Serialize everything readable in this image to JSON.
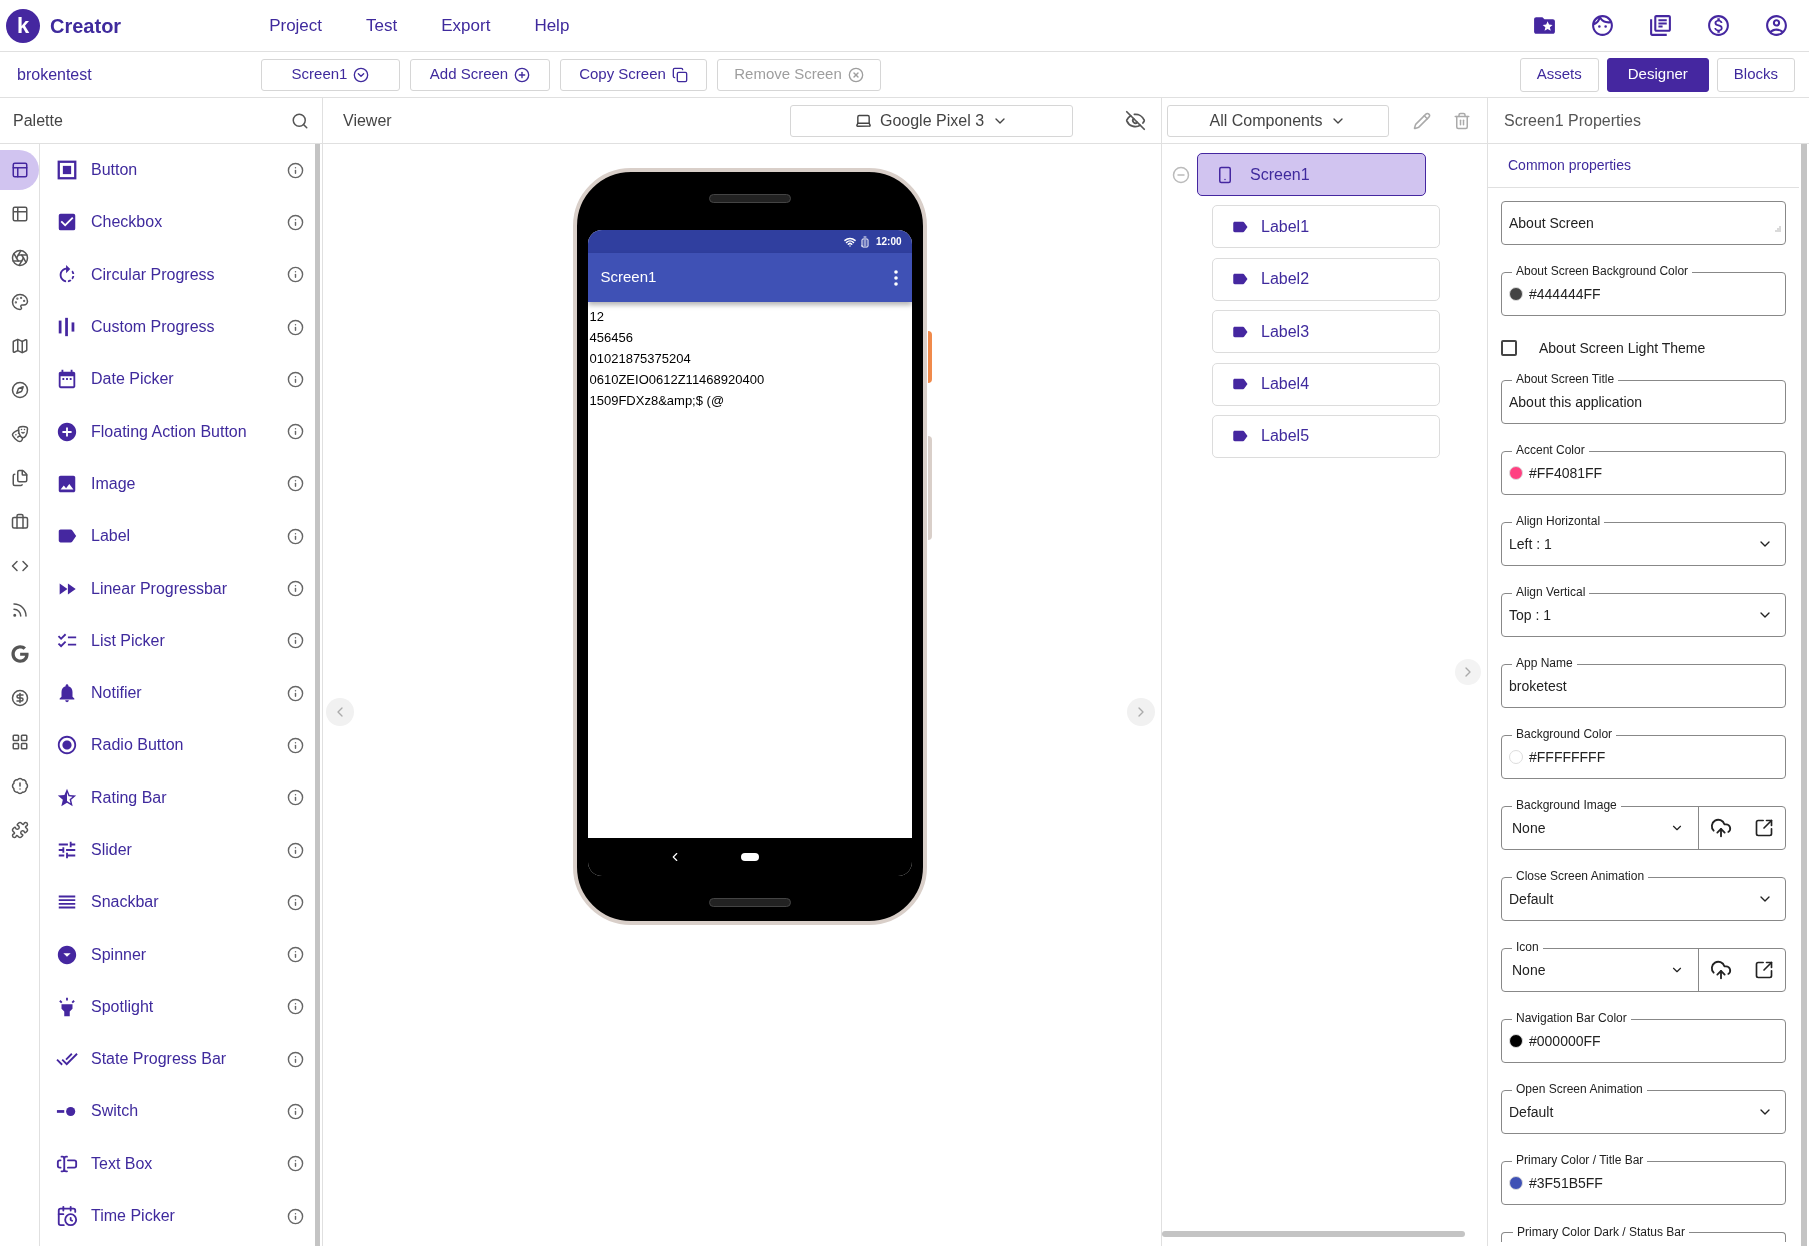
{
  "app": {
    "logo_mark": "k",
    "name": "Creator"
  },
  "menu": [
    "Project",
    "Test",
    "Export",
    "Help"
  ],
  "project": {
    "name": "brokentest"
  },
  "screen_actions": [
    {
      "kind": "dropdown",
      "label": "Screen1",
      "disabled": false
    },
    {
      "kind": "add",
      "label": "Add Screen",
      "disabled": false
    },
    {
      "kind": "copy",
      "label": "Copy Screen",
      "disabled": false
    },
    {
      "kind": "remove",
      "label": "Remove Screen",
      "disabled": true
    }
  ],
  "view_tabs": [
    {
      "label": "Assets",
      "selected": false
    },
    {
      "label": "Designer",
      "selected": true
    },
    {
      "label": "Blocks",
      "selected": false
    }
  ],
  "palette": {
    "title": "Palette",
    "categories": [
      {
        "selected": true
      },
      {
        "selected": false
      },
      {
        "selected": false
      },
      {
        "selected": false
      },
      {
        "selected": false
      },
      {
        "selected": false
      },
      {
        "selected": false
      },
      {
        "selected": false
      },
      {
        "selected": false
      },
      {
        "selected": false
      },
      {
        "selected": false
      },
      {
        "selected": false
      },
      {
        "selected": false
      },
      {
        "selected": false
      },
      {
        "selected": false
      },
      {
        "selected": false
      }
    ],
    "items": [
      "Button",
      "Checkbox",
      "Circular Progress",
      "Custom Progress",
      "Date Picker",
      "Floating Action Button",
      "Image",
      "Label",
      "Linear Progressbar",
      "List Picker",
      "Notifier",
      "Radio Button",
      "Rating Bar",
      "Slider",
      "Snackbar",
      "Spinner",
      "Spotlight",
      "State Progress Bar",
      "Switch",
      "Text Box",
      "Time Picker"
    ]
  },
  "viewer": {
    "title": "Viewer",
    "device": "Google Pixel 3",
    "phone": {
      "status_time": "12:00",
      "title": "Screen1",
      "labels": [
        "12",
        "456456",
        "01021875375204",
        "0610ZEIO0612Z11468920400",
        "1509FDXz8&amp;$ (@"
      ]
    }
  },
  "components": {
    "filter": "All Components",
    "tree": [
      {
        "name": "Screen1",
        "kind": "screen",
        "selected": true,
        "expanded": true,
        "children": [
          {
            "name": "Label1",
            "kind": "label",
            "selected": false
          },
          {
            "name": "Label2",
            "kind": "label",
            "selected": false
          },
          {
            "name": "Label3",
            "kind": "label",
            "selected": false
          },
          {
            "name": "Label4",
            "kind": "label",
            "selected": false
          },
          {
            "name": "Label5",
            "kind": "label",
            "selected": false
          }
        ]
      }
    ]
  },
  "properties": {
    "title": "Screen1 Properties",
    "section": "Common properties",
    "items": [
      {
        "kind": "textarea",
        "value": "About Screen"
      },
      {
        "kind": "color",
        "label": "About Screen Background Color",
        "value": "#444444FF",
        "color": "#444444"
      },
      {
        "kind": "checkbox",
        "label": "About Screen Light Theme",
        "checked": false
      },
      {
        "kind": "text",
        "label": "About Screen Title",
        "value": "About this application"
      },
      {
        "kind": "color",
        "label": "Accent Color",
        "value": "#FF4081FF",
        "color": "#ff4081"
      },
      {
        "kind": "select",
        "label": "Align Horizontal",
        "value": "Left : 1"
      },
      {
        "kind": "select",
        "label": "Align Vertical",
        "value": "Top : 1"
      },
      {
        "kind": "text",
        "label": "App Name",
        "value": "broketest"
      },
      {
        "kind": "color",
        "label": "Background Color",
        "value": "#FFFFFFFF",
        "color": "#ffffff"
      },
      {
        "kind": "asset",
        "label": "Background Image",
        "value": "None"
      },
      {
        "kind": "select",
        "label": "Close Screen Animation",
        "value": "Default"
      },
      {
        "kind": "asset",
        "label": "Icon",
        "value": "None"
      },
      {
        "kind": "color",
        "label": "Navigation Bar Color",
        "value": "#000000FF",
        "color": "#000000"
      },
      {
        "kind": "select",
        "label": "Open Screen Animation",
        "value": "Default"
      },
      {
        "kind": "color",
        "label": "Primary Color / Title Bar",
        "value": "#3F51B5FF",
        "color": "#3f51b5"
      },
      {
        "kind": "cut",
        "label": "Primary Color Dark / Status Bar"
      }
    ]
  }
}
